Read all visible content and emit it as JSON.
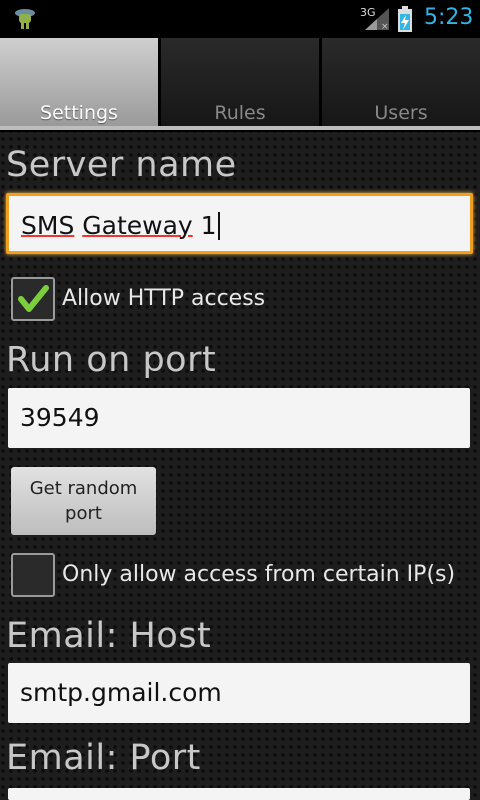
{
  "statusbar": {
    "network": "3G",
    "time": "5:23",
    "icons": [
      "android-debug-icon",
      "signal-icon",
      "battery-charging-icon"
    ]
  },
  "tabs": [
    {
      "label": "Settings",
      "active": true
    },
    {
      "label": "Rules",
      "active": false
    },
    {
      "label": "Users",
      "active": false
    }
  ],
  "form": {
    "server_name_label": "Server name",
    "server_name_words": [
      "SMS",
      "Gateway",
      "1"
    ],
    "allow_http_label": "Allow HTTP access",
    "allow_http_checked": true,
    "port_label": "Run on port",
    "port_value": "39549",
    "random_port_button": "Get random port",
    "ip_restrict_label": "Only allow access from certain IP(s)",
    "ip_restrict_checked": false,
    "email_host_label": "Email: Host",
    "email_host_value": "smtp.gmail.com",
    "email_port_label": "Email: Port"
  },
  "colors": {
    "accent": "#33b5e5",
    "focus": "#f0a020",
    "check": "#7ccf3c"
  }
}
